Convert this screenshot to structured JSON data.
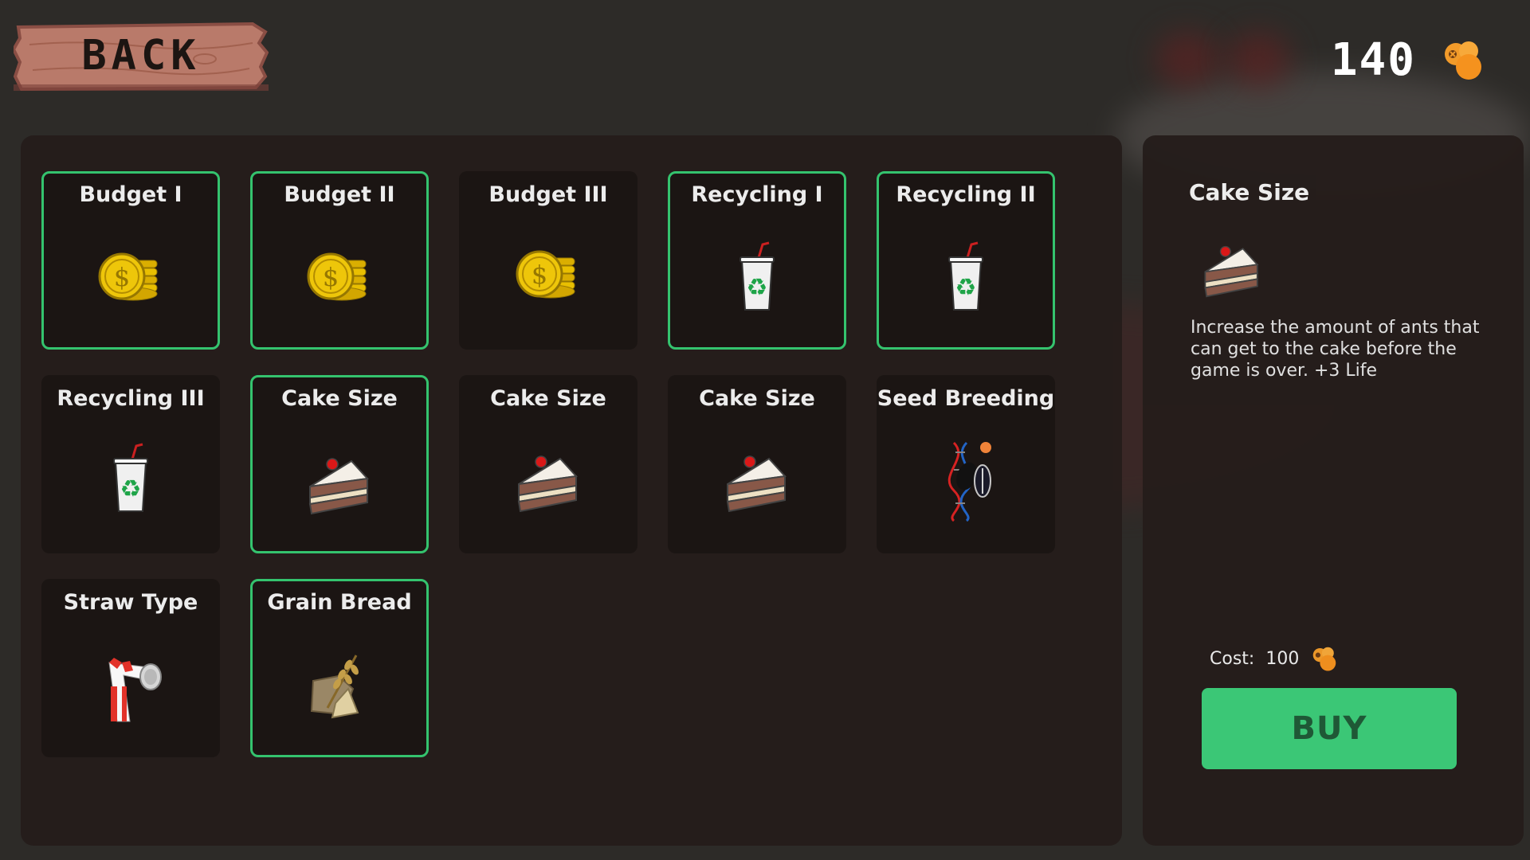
{
  "header": {
    "back_label": "BACK",
    "currency_value": "140",
    "currency_icon": "seed-coin-icon"
  },
  "colors": {
    "owned_border": "#35c871",
    "buy_button": "#3ccd79",
    "buy_text": "#1f5a37",
    "panel": "#251d1b",
    "card": "#1b1513"
  },
  "upgrades": [
    {
      "title": "Budget I",
      "icon": "gold-coins-icon",
      "owned": true
    },
    {
      "title": "Budget II",
      "icon": "gold-coins-icon",
      "owned": true
    },
    {
      "title": "Budget III",
      "icon": "gold-coins-icon",
      "owned": false
    },
    {
      "title": "Recycling I",
      "icon": "recycling-cup-icon",
      "owned": true
    },
    {
      "title": "Recycling II",
      "icon": "recycling-cup-icon",
      "owned": true
    },
    {
      "title": "Recycling III",
      "icon": "recycling-cup-icon",
      "owned": false
    },
    {
      "title": "Cake Size",
      "icon": "cake-slice-icon",
      "owned": true
    },
    {
      "title": "Cake Size",
      "icon": "cake-slice-icon",
      "owned": false
    },
    {
      "title": "Cake Size",
      "icon": "cake-slice-icon",
      "owned": false
    },
    {
      "title": "Seed Breeding",
      "icon": "dna-seed-icon",
      "owned": false
    },
    {
      "title": "Straw Type",
      "icon": "striped-straw-icon",
      "owned": false
    },
    {
      "title": "Grain Bread",
      "icon": "grain-bread-icon",
      "owned": true
    }
  ],
  "detail": {
    "title": "Cake Size",
    "icon": "cake-slice-icon",
    "description": "Increase the amount of ants that can get to the cake before the game is over. +3 Life",
    "cost_label": "Cost:",
    "cost_value": "100",
    "buy_label": "BUY"
  }
}
